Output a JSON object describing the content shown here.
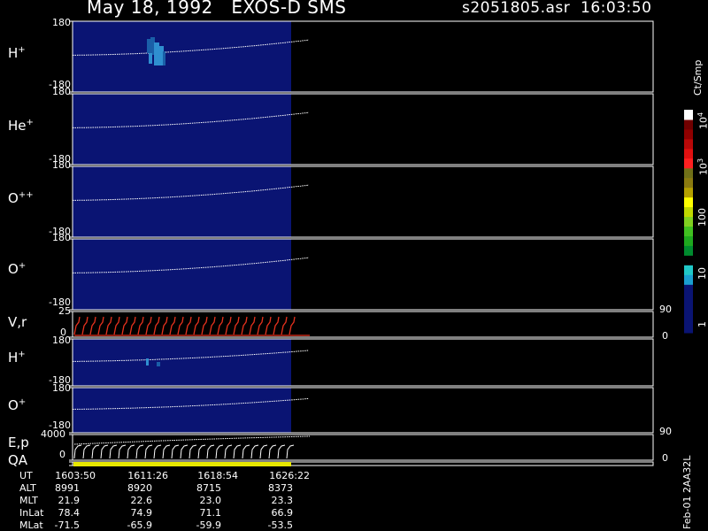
{
  "header": {
    "title": "May 18, 1992   EXOS-D SMS",
    "file_time": "s2051805.asr  16:03:50"
  },
  "colors": {
    "background": "#000000",
    "fill": "#0a1473",
    "velocity_trace": "#e8321e",
    "energy_trace": "#ffffff",
    "qa_bar": "#e8e800",
    "hplus_spot_light": "#2f8fd0",
    "hplus_spot_dark": "#1a5fa8"
  },
  "chart_data": {
    "type": "heatmap",
    "panels": [
      {
        "name": "H+",
        "label_base": "H",
        "label_sup": "+",
        "yrange": [
          -180,
          180
        ],
        "top_tick": "180",
        "bottom_tick": "-180"
      },
      {
        "name": "He+",
        "label_base": "He",
        "label_sup": "+",
        "yrange": [
          -180,
          180
        ],
        "top_tick": "180",
        "bottom_tick": "-180"
      },
      {
        "name": "O++",
        "label_base": "O",
        "label_sup": "++",
        "yrange": [
          -180,
          180
        ],
        "top_tick": "180",
        "bottom_tick": "-180"
      },
      {
        "name": "O+",
        "label_base": "O",
        "label_sup": "+",
        "yrange": [
          -180,
          180
        ],
        "top_tick": "180",
        "bottom_tick": "-180"
      },
      {
        "name": "V,r",
        "label_base": "V,r",
        "label_sup": "",
        "yrange": [
          0,
          25
        ],
        "top_tick": "25",
        "bottom_tick": "0",
        "right_top": "90",
        "right_bottom": "0"
      },
      {
        "name": "H+",
        "label_base": "H",
        "label_sup": "+",
        "yrange": [
          -180,
          180
        ],
        "top_tick": "180",
        "bottom_tick": "-180"
      },
      {
        "name": "O+",
        "label_base": "O",
        "label_sup": "+",
        "yrange": [
          -180,
          180
        ],
        "top_tick": "180",
        "bottom_tick": "-180"
      },
      {
        "name": "E,p",
        "label_base": "E,p",
        "label_sup": "",
        "yrange": [
          0,
          4000
        ],
        "top_tick": "4000",
        "bottom_tick": "0",
        "right_top": "90",
        "right_bottom": "0"
      },
      {
        "name": "QA",
        "label_base": "QA",
        "label_sup": "",
        "yrange": [
          0,
          1
        ],
        "top_tick": "",
        "bottom_tick": ""
      }
    ],
    "time_axis": {
      "rows": [
        {
          "label": "UT",
          "values": [
            "1603:50",
            "1611:26",
            "1618:54",
            "1626:22"
          ]
        },
        {
          "label": "ALT",
          "values": [
            "8991",
            "8920",
            "8715",
            "8373"
          ]
        },
        {
          "label": "MLT",
          "values": [
            "21.9",
            "22.6",
            "23.0",
            "23.3"
          ]
        },
        {
          "label": "InLat",
          "values": [
            "78.4",
            "74.9",
            "71.1",
            "66.9"
          ]
        },
        {
          "label": "MLat",
          "values": [
            "-71.5",
            "-65.9",
            "-59.9",
            "-53.5"
          ]
        }
      ]
    },
    "colorbar": {
      "label": "Ct/Smp",
      "ticks": [
        {
          "text": "1",
          "sup": ""
        },
        {
          "text": "10",
          "sup": ""
        },
        {
          "text": "100",
          "sup": ""
        },
        {
          "text": "10",
          "sup": "3"
        },
        {
          "text": "10",
          "sup": "4"
        }
      ],
      "colors": [
        "#0a1473",
        "#0a1473",
        "#0a1473",
        "#0a1473",
        "#0a1473",
        "#1a9fd0",
        "#20c8c8",
        "#000000",
        "#008b2e",
        "#1ea81e",
        "#40c020",
        "#80d020",
        "#c0d800",
        "#ffff00",
        "#b4a000",
        "#8a7a10",
        "#707018",
        "#ff2020",
        "#e01010",
        "#b80808",
        "#900000",
        "#700000",
        "#ffffff"
      ]
    }
  },
  "footer": {
    "side_id": "Feb-01 2AA32L"
  }
}
